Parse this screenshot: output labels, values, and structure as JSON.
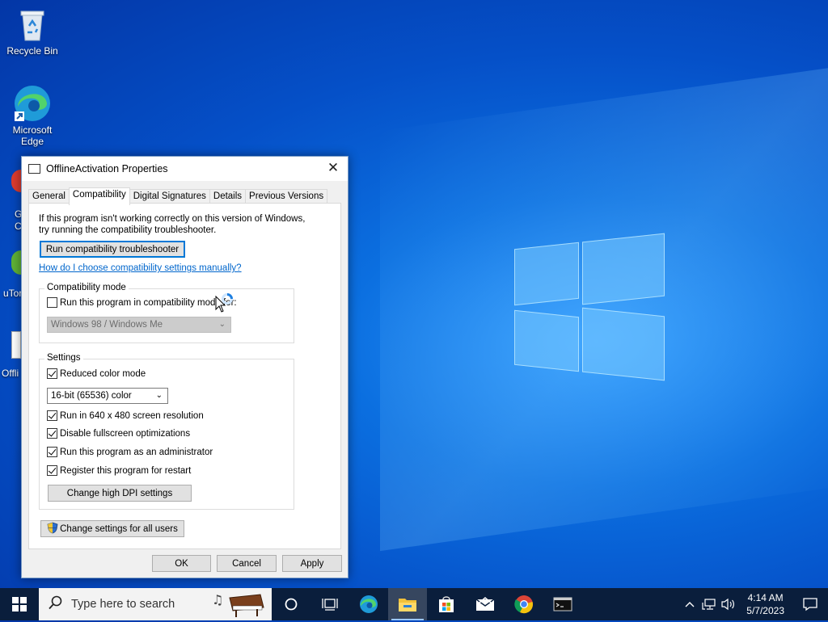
{
  "desktop": {
    "icons": [
      {
        "label": "Recycle Bin"
      },
      {
        "label": "Microsoft Edge"
      }
    ],
    "partial_labels": [
      "G",
      "C",
      "uTor",
      "Offli"
    ]
  },
  "dialog": {
    "title": "OfflineActivation Properties",
    "close_glyph": "✕",
    "tabs": [
      "General",
      "Compatibility",
      "Digital Signatures",
      "Details",
      "Previous Versions"
    ],
    "intro_text": "If this program isn't working correctly on this version of Windows, try running the compatibility troubleshooter.",
    "troubleshooter_button": "Run compatibility troubleshooter",
    "manual_link": "How do I choose compatibility settings manually?",
    "compat_mode": {
      "title": "Compatibility mode",
      "checkbox_label": "Run this program in compatibility mode for:",
      "checked": false,
      "os_value": "Windows 98 / Windows Me"
    },
    "settings": {
      "title": "Settings",
      "reduced_color": {
        "label": "Reduced color mode",
        "checked": true
      },
      "color_value": "16-bit (65536) color",
      "res_640": {
        "label": "Run in 640 x 480 screen resolution",
        "checked": true
      },
      "disable_fullscreen": {
        "label": "Disable fullscreen optimizations",
        "checked": true
      },
      "run_admin": {
        "label": "Run this program as an administrator",
        "checked": true
      },
      "register_restart": {
        "label": "Register this program for restart",
        "checked": true
      },
      "dpi_button": "Change high DPI settings"
    },
    "all_users_button": "Change settings for all users",
    "ok_button": "OK",
    "cancel_button": "Cancel",
    "apply_button": "Apply"
  },
  "taskbar": {
    "search_placeholder": "Type here to search",
    "time": "4:14 AM",
    "date": "5/7/2023"
  },
  "colors": {
    "accent": "#0078d7",
    "link": "#0066cc",
    "taskbar": "#0a1e3c"
  }
}
